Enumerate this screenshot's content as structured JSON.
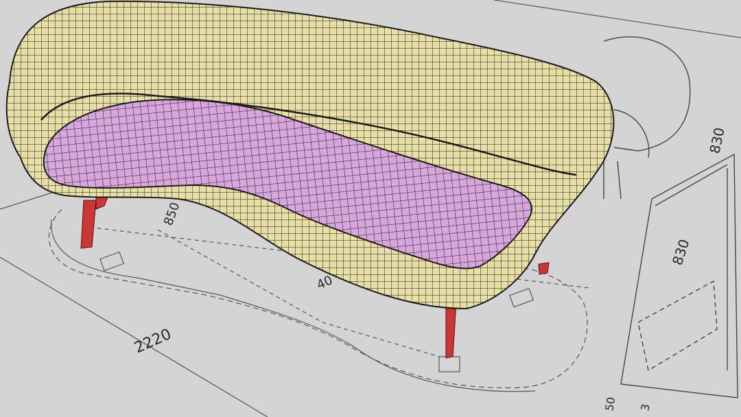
{
  "viewport": {
    "background": "#d4d4d4",
    "line_color": "#555555"
  },
  "model": {
    "frame_color": "#e7dfa6",
    "seat_color": "#d8a6dc",
    "legs_color": "#c93737",
    "wire_color": "#1a1a1a"
  },
  "dimensions": {
    "overall_length": "2220",
    "seat_depth": "850",
    "offset": "40",
    "side_height": "830",
    "side_height_2": "830",
    "side_small_1": "50",
    "side_small_2": "3"
  }
}
